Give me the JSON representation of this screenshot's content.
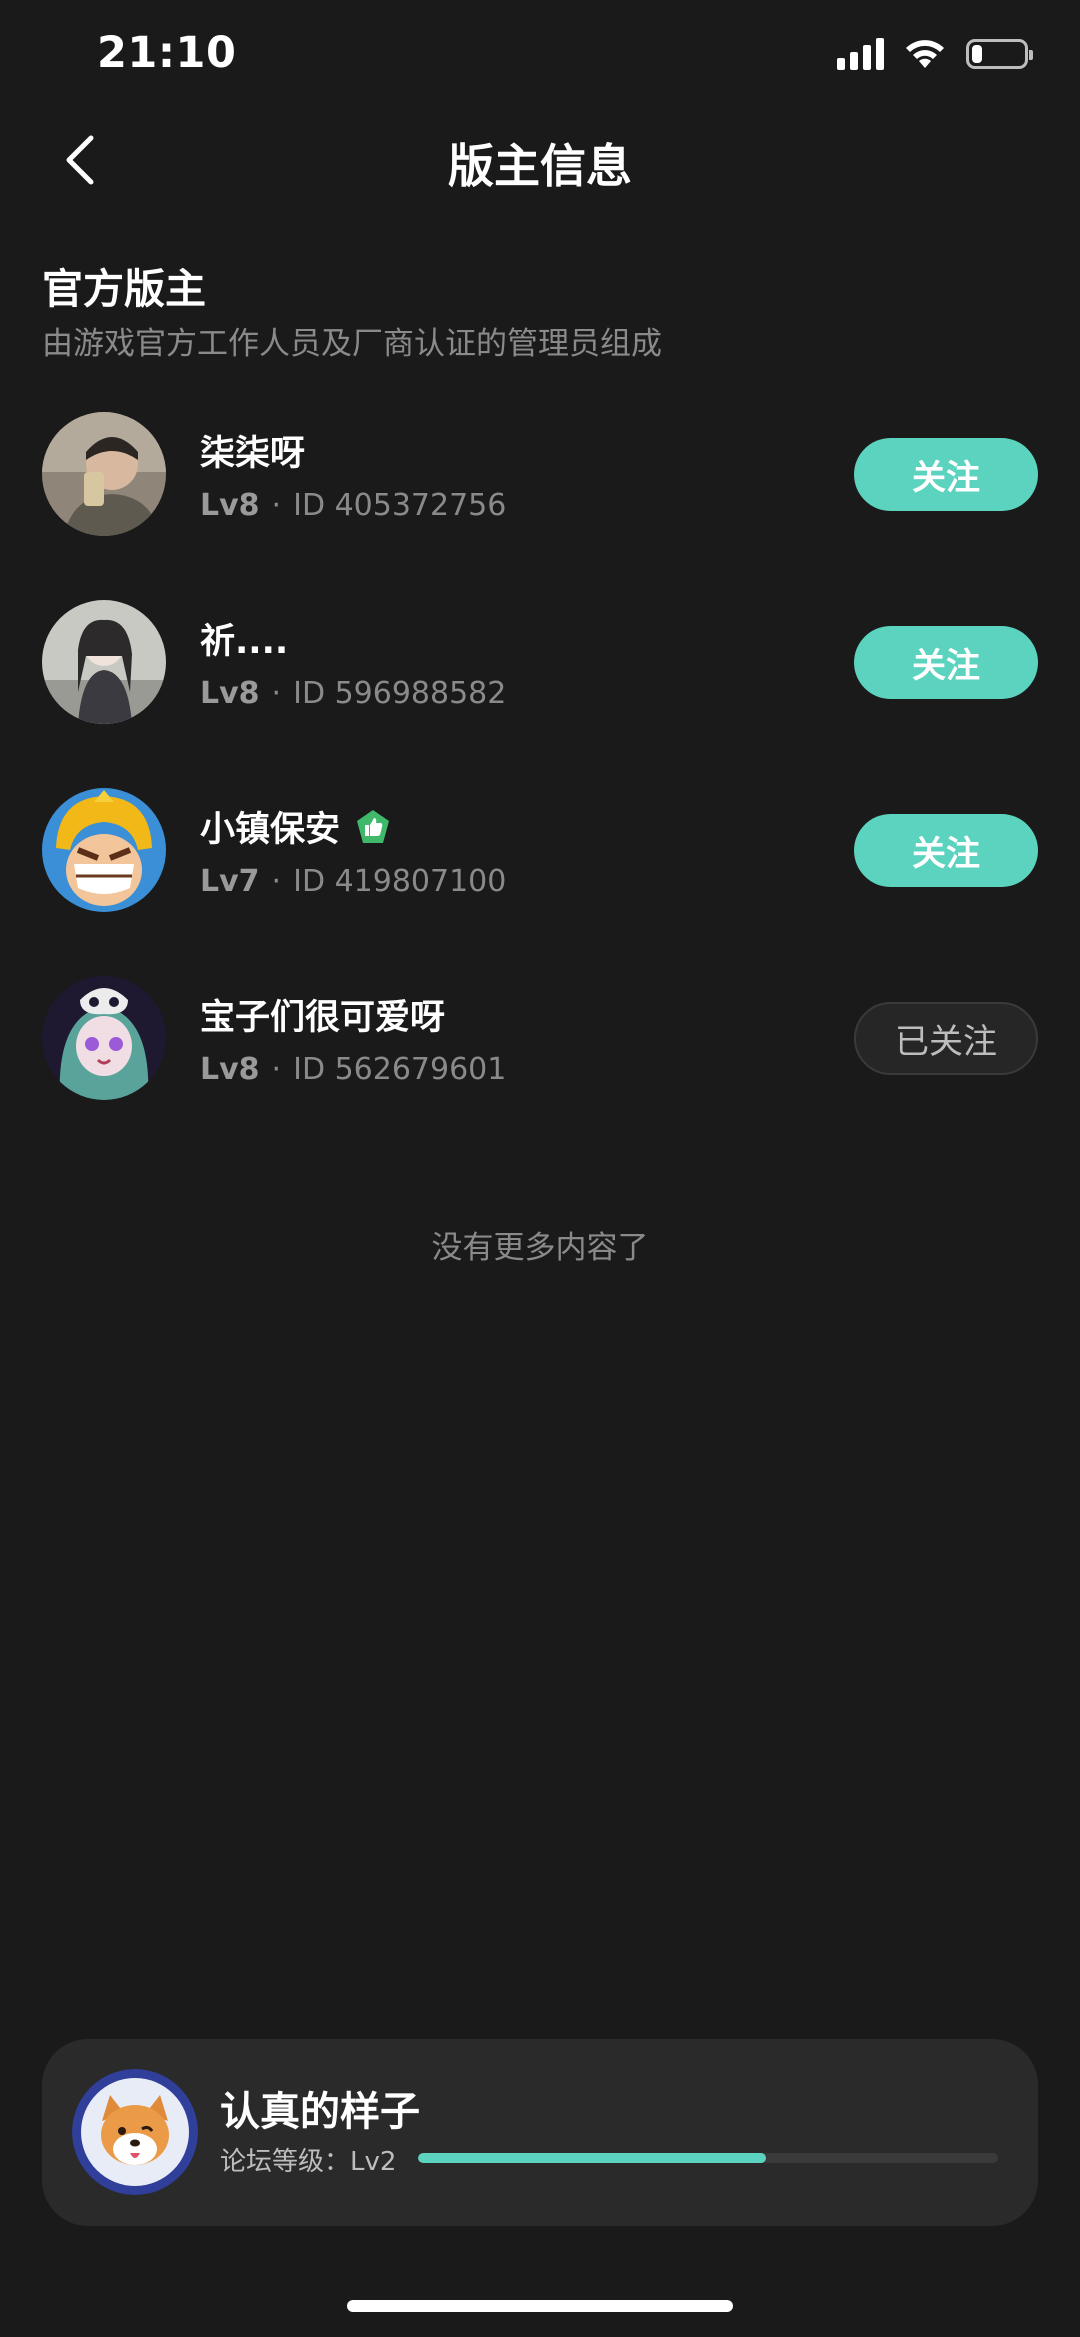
{
  "status_bar": {
    "time": "21:10",
    "battery_level": 0.2
  },
  "header": {
    "title": "版主信息",
    "back_icon": "chevron-left-icon"
  },
  "section": {
    "title": "官方版主",
    "subtitle": "由游戏官方工作人员及厂商认证的管理员组成"
  },
  "moderators": [
    {
      "name": "柒柒呀",
      "level": "Lv8",
      "id": "ID 405372756",
      "button": "关注",
      "followed": false,
      "badge": false
    },
    {
      "name": "祈....",
      "level": "Lv8",
      "id": "ID 596988582",
      "button": "关注",
      "followed": false,
      "badge": false
    },
    {
      "name": "小镇保安",
      "level": "Lv7",
      "id": "ID 419807100",
      "button": "关注",
      "followed": false,
      "badge": true,
      "badge_icon": "thumbs-up-badge-icon"
    },
    {
      "name": "宝子们很可爱呀",
      "level": "Lv8",
      "id": "ID 562679601",
      "button": "已关注",
      "followed": true,
      "badge": false
    }
  ],
  "separator": "·",
  "no_more": "没有更多内容了",
  "user_card": {
    "name": "认真的样子",
    "level_label": "论坛等级：Lv2",
    "progress": 0.6
  },
  "colors": {
    "accent": "#5cd3bf",
    "background": "#1a1a1a",
    "card": "#2a2a2a",
    "muted_text": "#8a8a8a",
    "badge_green": "#3fb86a"
  }
}
